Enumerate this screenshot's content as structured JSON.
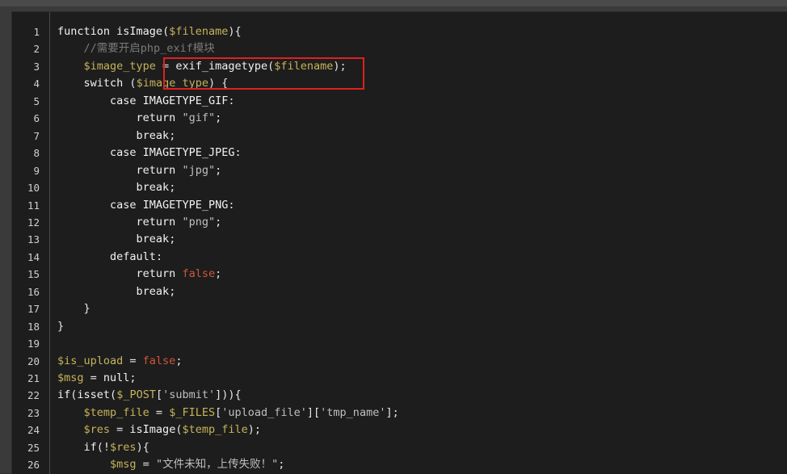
{
  "editor": {
    "lines": [
      {
        "n": "1",
        "tokens": [
          {
            "t": "function ",
            "c": "kw"
          },
          {
            "t": "isImage",
            "c": "fn"
          },
          {
            "t": "(",
            "c": "punc"
          },
          {
            "t": "$filename",
            "c": "var"
          },
          {
            "t": "){",
            "c": "punc"
          }
        ]
      },
      {
        "n": "2",
        "tokens": [
          {
            "t": "    ",
            "c": "punc"
          },
          {
            "t": "//需要开启php_exif模块",
            "c": "cmt"
          }
        ]
      },
      {
        "n": "3",
        "tokens": [
          {
            "t": "    ",
            "c": "punc"
          },
          {
            "t": "$image_type",
            "c": "var"
          },
          {
            "t": " = ",
            "c": "punc"
          },
          {
            "t": "exif_imagetype",
            "c": "fn"
          },
          {
            "t": "(",
            "c": "punc"
          },
          {
            "t": "$filename",
            "c": "var"
          },
          {
            "t": ");",
            "c": "punc"
          }
        ]
      },
      {
        "n": "4",
        "tokens": [
          {
            "t": "    ",
            "c": "punc"
          },
          {
            "t": "switch ",
            "c": "kw"
          },
          {
            "t": "(",
            "c": "punc"
          },
          {
            "t": "$image_type",
            "c": "var"
          },
          {
            "t": ") {",
            "c": "punc"
          }
        ]
      },
      {
        "n": "5",
        "tokens": [
          {
            "t": "        ",
            "c": "punc"
          },
          {
            "t": "case ",
            "c": "kw"
          },
          {
            "t": "IMAGETYPE_GIF",
            "c": "fn"
          },
          {
            "t": ":",
            "c": "punc"
          }
        ]
      },
      {
        "n": "6",
        "tokens": [
          {
            "t": "            ",
            "c": "punc"
          },
          {
            "t": "return ",
            "c": "kw"
          },
          {
            "t": "\"gif\"",
            "c": "str"
          },
          {
            "t": ";",
            "c": "punc"
          }
        ]
      },
      {
        "n": "7",
        "tokens": [
          {
            "t": "            ",
            "c": "punc"
          },
          {
            "t": "break",
            "c": "kw"
          },
          {
            "t": ";",
            "c": "punc"
          }
        ]
      },
      {
        "n": "8",
        "tokens": [
          {
            "t": "        ",
            "c": "punc"
          },
          {
            "t": "case ",
            "c": "kw"
          },
          {
            "t": "IMAGETYPE_JPEG",
            "c": "fn"
          },
          {
            "t": ":",
            "c": "punc"
          }
        ]
      },
      {
        "n": "9",
        "tokens": [
          {
            "t": "            ",
            "c": "punc"
          },
          {
            "t": "return ",
            "c": "kw"
          },
          {
            "t": "\"jpg\"",
            "c": "str"
          },
          {
            "t": ";",
            "c": "punc"
          }
        ]
      },
      {
        "n": "10",
        "tokens": [
          {
            "t": "            ",
            "c": "punc"
          },
          {
            "t": "break",
            "c": "kw"
          },
          {
            "t": ";",
            "c": "punc"
          }
        ]
      },
      {
        "n": "11",
        "tokens": [
          {
            "t": "        ",
            "c": "punc"
          },
          {
            "t": "case ",
            "c": "kw"
          },
          {
            "t": "IMAGETYPE_PNG",
            "c": "fn"
          },
          {
            "t": ":",
            "c": "punc"
          }
        ]
      },
      {
        "n": "12",
        "tokens": [
          {
            "t": "            ",
            "c": "punc"
          },
          {
            "t": "return ",
            "c": "kw"
          },
          {
            "t": "\"png\"",
            "c": "str"
          },
          {
            "t": ";",
            "c": "punc"
          }
        ]
      },
      {
        "n": "13",
        "tokens": [
          {
            "t": "            ",
            "c": "punc"
          },
          {
            "t": "break",
            "c": "kw"
          },
          {
            "t": ";",
            "c": "punc"
          }
        ]
      },
      {
        "n": "14",
        "tokens": [
          {
            "t": "        ",
            "c": "punc"
          },
          {
            "t": "default",
            "c": "kw"
          },
          {
            "t": ":",
            "c": "punc"
          }
        ]
      },
      {
        "n": "15",
        "tokens": [
          {
            "t": "            ",
            "c": "punc"
          },
          {
            "t": "return ",
            "c": "kw"
          },
          {
            "t": "false",
            "c": "bool"
          },
          {
            "t": ";",
            "c": "punc"
          }
        ]
      },
      {
        "n": "16",
        "tokens": [
          {
            "t": "            ",
            "c": "punc"
          },
          {
            "t": "break",
            "c": "kw"
          },
          {
            "t": ";",
            "c": "punc"
          }
        ]
      },
      {
        "n": "17",
        "tokens": [
          {
            "t": "    }",
            "c": "punc"
          }
        ]
      },
      {
        "n": "18",
        "tokens": [
          {
            "t": "}",
            "c": "punc"
          }
        ]
      },
      {
        "n": "19",
        "tokens": []
      },
      {
        "n": "20",
        "tokens": [
          {
            "t": "$is_upload",
            "c": "var"
          },
          {
            "t": " = ",
            "c": "punc"
          },
          {
            "t": "false",
            "c": "bool"
          },
          {
            "t": ";",
            "c": "punc"
          }
        ]
      },
      {
        "n": "21",
        "tokens": [
          {
            "t": "$msg",
            "c": "var"
          },
          {
            "t": " = ",
            "c": "punc"
          },
          {
            "t": "null",
            "c": "kw"
          },
          {
            "t": ";",
            "c": "punc"
          }
        ]
      },
      {
        "n": "22",
        "tokens": [
          {
            "t": "if",
            "c": "kw"
          },
          {
            "t": "(",
            "c": "punc"
          },
          {
            "t": "isset",
            "c": "fn"
          },
          {
            "t": "(",
            "c": "punc"
          },
          {
            "t": "$_POST",
            "c": "var"
          },
          {
            "t": "[",
            "c": "punc"
          },
          {
            "t": "'submit'",
            "c": "str"
          },
          {
            "t": "])){",
            "c": "punc"
          }
        ]
      },
      {
        "n": "23",
        "tokens": [
          {
            "t": "    ",
            "c": "punc"
          },
          {
            "t": "$temp_file",
            "c": "var"
          },
          {
            "t": " = ",
            "c": "punc"
          },
          {
            "t": "$_FILES",
            "c": "var"
          },
          {
            "t": "[",
            "c": "punc"
          },
          {
            "t": "'upload_file'",
            "c": "str"
          },
          {
            "t": "][",
            "c": "punc"
          },
          {
            "t": "'tmp_name'",
            "c": "str"
          },
          {
            "t": "];",
            "c": "punc"
          }
        ]
      },
      {
        "n": "24",
        "tokens": [
          {
            "t": "    ",
            "c": "punc"
          },
          {
            "t": "$res",
            "c": "var"
          },
          {
            "t": " = ",
            "c": "punc"
          },
          {
            "t": "isImage",
            "c": "fn"
          },
          {
            "t": "(",
            "c": "punc"
          },
          {
            "t": "$temp_file",
            "c": "var"
          },
          {
            "t": ");",
            "c": "punc"
          }
        ]
      },
      {
        "n": "25",
        "tokens": [
          {
            "t": "    ",
            "c": "punc"
          },
          {
            "t": "if",
            "c": "kw"
          },
          {
            "t": "(!",
            "c": "punc"
          },
          {
            "t": "$res",
            "c": "var"
          },
          {
            "t": "){",
            "c": "punc"
          }
        ]
      },
      {
        "n": "26",
        "tokens": [
          {
            "t": "        ",
            "c": "punc"
          },
          {
            "t": "$msg",
            "c": "var"
          },
          {
            "t": " = ",
            "c": "punc"
          },
          {
            "t": "\"文件未知，上传失败！\"",
            "c": "str"
          },
          {
            "t": ";",
            "c": "punc"
          }
        ]
      }
    ]
  },
  "colors": {
    "background": "#1d1d1d",
    "highlight_box": "#e02020",
    "variable": "#c6b35a",
    "boolean": "#d0563a",
    "comment": "#7a7a7a"
  }
}
